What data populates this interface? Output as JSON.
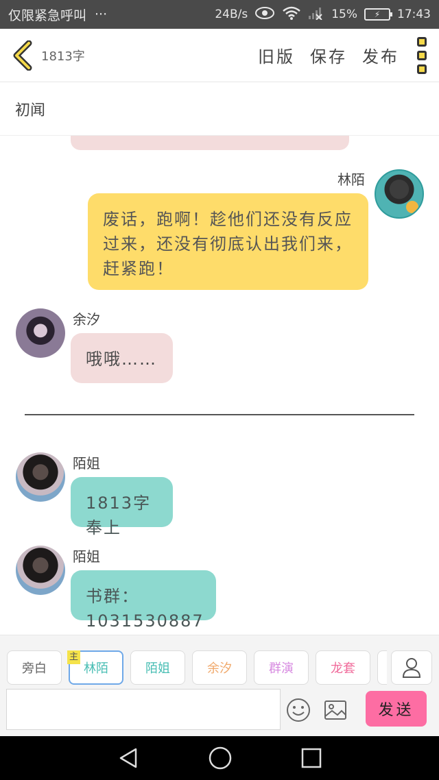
{
  "status_bar": {
    "left_text": "仅限紧急呼叫",
    "overflow": "···",
    "speed": "24B/s",
    "battery_percent": "15%",
    "time": "17:43"
  },
  "header": {
    "word_count": "1813字",
    "old_version": "旧版",
    "save": "保存",
    "publish": "发布"
  },
  "chapter": {
    "title": "初闻"
  },
  "messages": [
    {
      "name": "林陌",
      "text": "废话，跑啊！趁他们还没有反应过来，还没有彻底认出我们来，赶紧跑！",
      "side": "right",
      "color": "yellow"
    },
    {
      "name": "余汐",
      "text": "哦哦……",
      "side": "left",
      "color": "pink"
    },
    {
      "name": "陌姐",
      "text": "1813字奉上",
      "side": "left",
      "color": "teal"
    },
    {
      "name": "陌姐",
      "text": "书群：1031530887",
      "side": "left",
      "color": "teal"
    }
  ],
  "divider_text": "",
  "composer": {
    "roles": [
      {
        "label": "旁白",
        "color": "#666666"
      },
      {
        "label": "林陌",
        "color": "#47bdb3",
        "tag": "主"
      },
      {
        "label": "陌姐",
        "color": "#47bdb3"
      },
      {
        "label": "余汐",
        "color": "#f0a86a"
      },
      {
        "label": "群演",
        "color": "#d78ae0"
      },
      {
        "label": "龙套",
        "color": "#f06a9a"
      }
    ],
    "input_placeholder": "",
    "send": "发送"
  },
  "colors": {
    "accent_yellow": "#fedc6a",
    "bubble_pink": "#f3dcdc",
    "bubble_teal": "#8dd9cf",
    "send_pink": "#fd6da3"
  }
}
